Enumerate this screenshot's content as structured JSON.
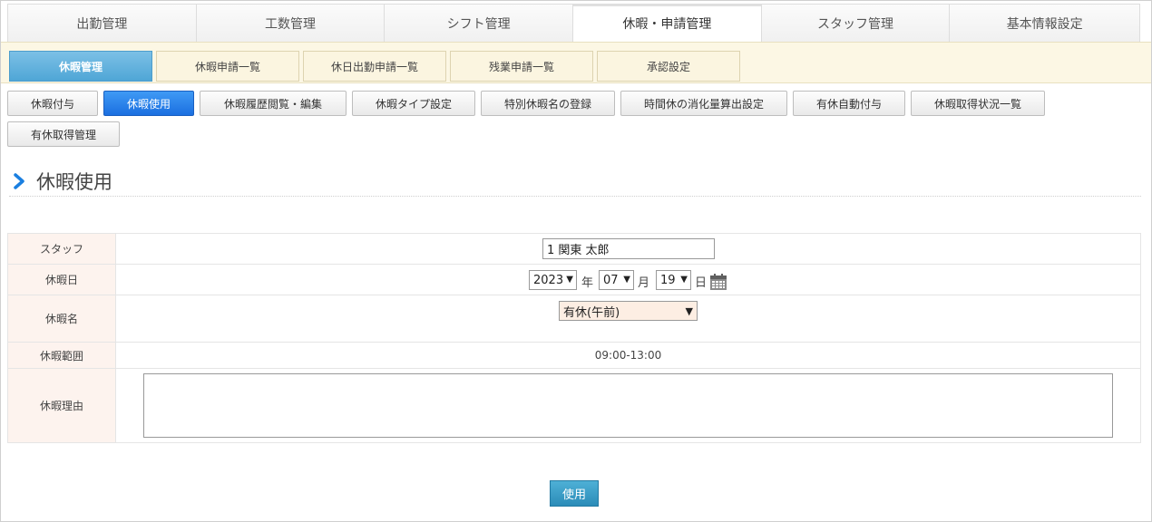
{
  "top_tabs": [
    {
      "label": "出勤管理"
    },
    {
      "label": "工数管理"
    },
    {
      "label": "シフト管理"
    },
    {
      "label": "休暇・申請管理"
    },
    {
      "label": "スタッフ管理"
    },
    {
      "label": "基本情報設定"
    }
  ],
  "sub_tabs": [
    {
      "label": "休暇管理"
    },
    {
      "label": "休暇申請一覧"
    },
    {
      "label": "休日出勤申請一覧"
    },
    {
      "label": "残業申請一覧"
    },
    {
      "label": "承認設定"
    }
  ],
  "actions": [
    {
      "label": "休暇付与"
    },
    {
      "label": "休暇使用"
    },
    {
      "label": "休暇履歴閲覧・編集"
    },
    {
      "label": "休暇タイプ設定"
    },
    {
      "label": "特別休暇名の登録"
    },
    {
      "label": "時間休の消化量算出設定"
    },
    {
      "label": "有休自動付与"
    },
    {
      "label": "休暇取得状況一覧"
    },
    {
      "label": "有休取得管理"
    }
  ],
  "section": {
    "title": "休暇使用"
  },
  "form": {
    "staff_label": "スタッフ",
    "staff_value": "1 関東 太郎",
    "date_label": "休暇日",
    "year": "2023",
    "year_unit": "年",
    "month": "07",
    "month_unit": "月",
    "day": "19",
    "day_unit": "日",
    "leave_name_label": "休暇名",
    "leave_name_value": "有休(午前)",
    "range_label": "休暇範囲",
    "range_value": "09:00-13:00",
    "reason_label": "休暇理由",
    "reason_value": ""
  },
  "submit_label": "使用",
  "colors": {
    "active_tab_blue": "#4fa6d6",
    "active_action_blue": "#1b6fe0",
    "label_bg": "#fdf3ee",
    "sub_strip_bg": "#fcf7e4",
    "submit_bg": "#2b8cb8"
  },
  "icons": [
    "chevron-right-icon",
    "calendar-icon"
  ]
}
